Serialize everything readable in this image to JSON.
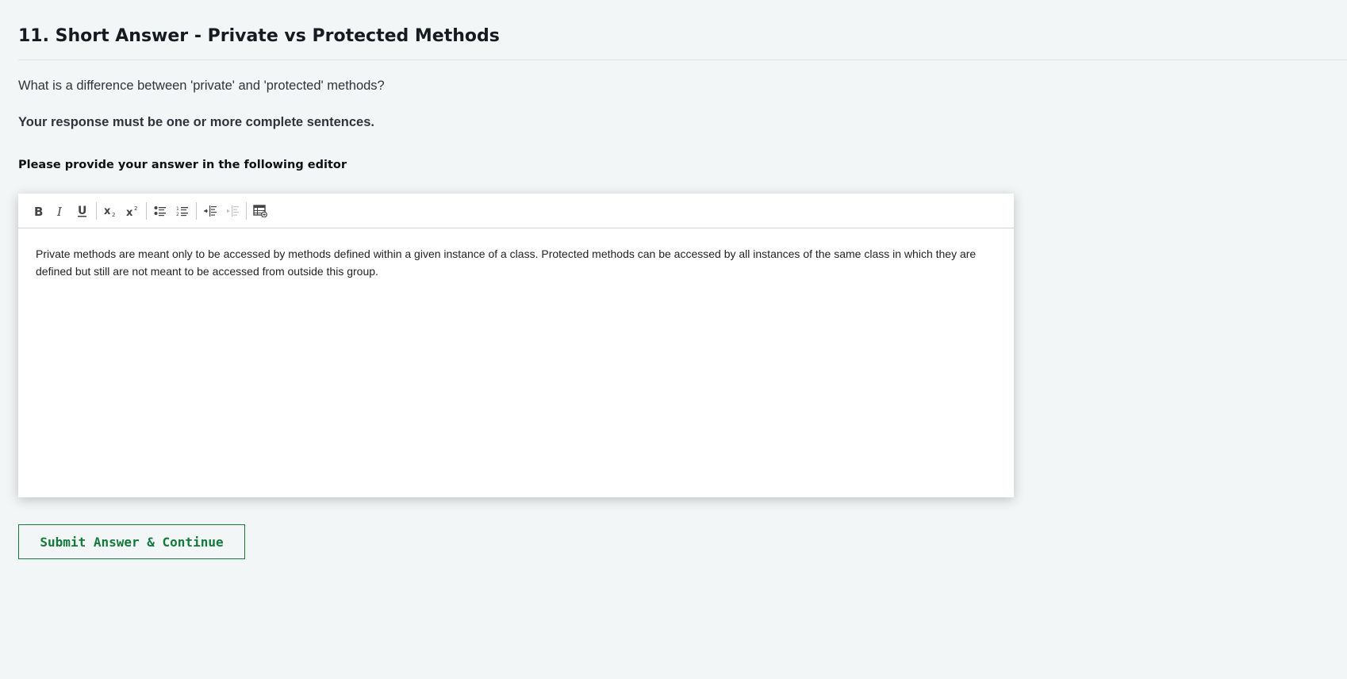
{
  "question": {
    "title": "11. Short Answer - Private vs Protected Methods",
    "prompt": "What is a difference between 'private' and 'protected' methods?",
    "requirement": "Your response must be one or more complete sentences."
  },
  "editor": {
    "label": "Please provide your answer in the following editor",
    "toolbar": {
      "items": [
        {
          "icon": "bold-icon",
          "enabled": true
        },
        {
          "icon": "italic-icon",
          "enabled": true
        },
        {
          "icon": "underline-icon",
          "enabled": true
        },
        {
          "icon": "subscript-icon",
          "enabled": true
        },
        {
          "icon": "superscript-icon",
          "enabled": true
        },
        {
          "icon": "bulleted-list-icon",
          "enabled": true
        },
        {
          "icon": "numbered-list-icon",
          "enabled": true
        },
        {
          "icon": "indent-icon",
          "enabled": true
        },
        {
          "icon": "outdent-icon",
          "enabled": false
        },
        {
          "icon": "insert-table-icon",
          "enabled": true
        }
      ]
    },
    "content": "Private methods are meant only to be accessed by methods defined within a given instance of a class. Protected methods can be accessed by all instances of the same class in which they are defined but still are not meant to be accessed from outside this group."
  },
  "actions": {
    "submit_label": "Submit Answer & Continue"
  },
  "colors": {
    "background": "#f2f6f6",
    "accent_green": "#137a3b"
  }
}
